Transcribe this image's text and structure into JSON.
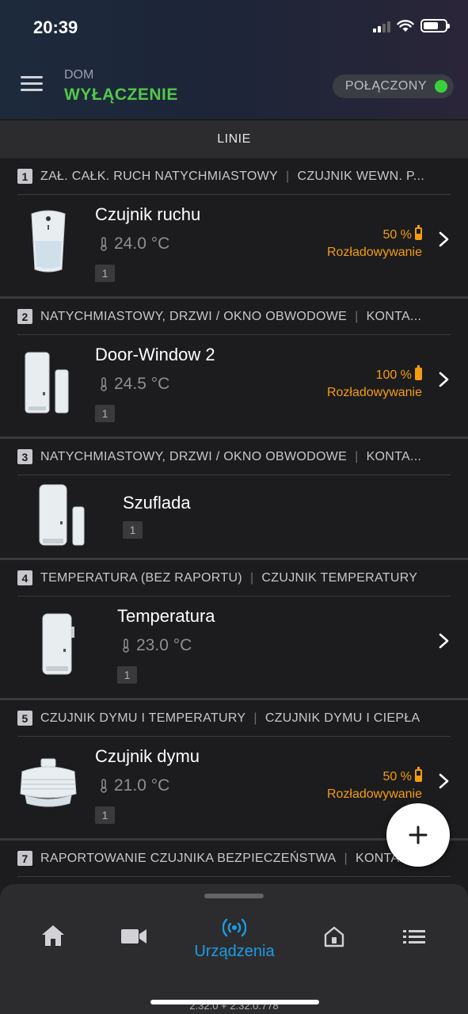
{
  "status_bar": {
    "time": "20:39"
  },
  "header": {
    "subtitle": "DOM",
    "mode": "WYŁĄCZENIE",
    "connection": "POŁĄCZONY",
    "mode_color": "#52c84a",
    "connection_dot_color": "#3ccf3c"
  },
  "section": {
    "title": "LINIE"
  },
  "zones": [
    {
      "number": "1",
      "type": "ZAŁ. CAŁK. RUCH NATYCHMIASTOWY",
      "detector": "CZUJNIK WEWN. P...",
      "device": {
        "name": "Czujnik ruchu",
        "icon": "motion-sensor-icon",
        "temperature": "24.0 °C",
        "badge": "1",
        "battery_level": "50 %",
        "battery_fraction": 0.5,
        "battery_status": "Rozładowywanie"
      }
    },
    {
      "number": "2",
      "type": "NATYCHMIASTOWY, DRZWI / OKNO OBWODOWE",
      "detector": "KONTA...",
      "device": {
        "name": "Door-Window 2",
        "icon": "door-window-sensor-icon",
        "temperature": "24.5 °C",
        "badge": "1",
        "battery_level": "100 %",
        "battery_fraction": 1.0,
        "battery_status": "Rozładowywanie"
      }
    },
    {
      "number": "3",
      "type": "NATYCHMIASTOWY, DRZWI / OKNO OBWODOWE",
      "detector": "KONTA...",
      "device": {
        "name": "Szuflada",
        "icon": "door-window-sensor-icon",
        "badge": "1"
      }
    },
    {
      "number": "4",
      "type": "TEMPERATURA (BEZ RAPORTU)",
      "detector": "CZUJNIK TEMPERATURY",
      "device": {
        "name": "Temperatura",
        "icon": "temperature-sensor-icon",
        "temperature": "23.0 °C",
        "badge": "1"
      }
    },
    {
      "number": "5",
      "type": "CZUJNIK DYMU I TEMPERATURY",
      "detector": "CZUJNIK DYMU I CIEPŁA",
      "device": {
        "name": "Czujnik dymu",
        "icon": "smoke-detector-icon",
        "temperature": "21.0 °C",
        "badge": "1",
        "battery_level": "50 %",
        "battery_fraction": 0.5,
        "battery_status": "Rozładowywanie"
      }
    },
    {
      "number": "7",
      "type": "RAPORTOWANIE CZUJNIKA BEZPIECZEŃSTWA",
      "detector": "KONTAKT..."
    }
  ],
  "bottom_nav": {
    "items": [
      {
        "icon": "home-icon"
      },
      {
        "icon": "camera-icon"
      },
      {
        "icon": "devices-icon",
        "label": "Urządzenia",
        "active": true
      },
      {
        "icon": "smart-home-icon"
      },
      {
        "icon": "list-icon"
      }
    ],
    "active_color": "#1e9be6"
  },
  "version": "2.32.0 + 2.32.0.778"
}
